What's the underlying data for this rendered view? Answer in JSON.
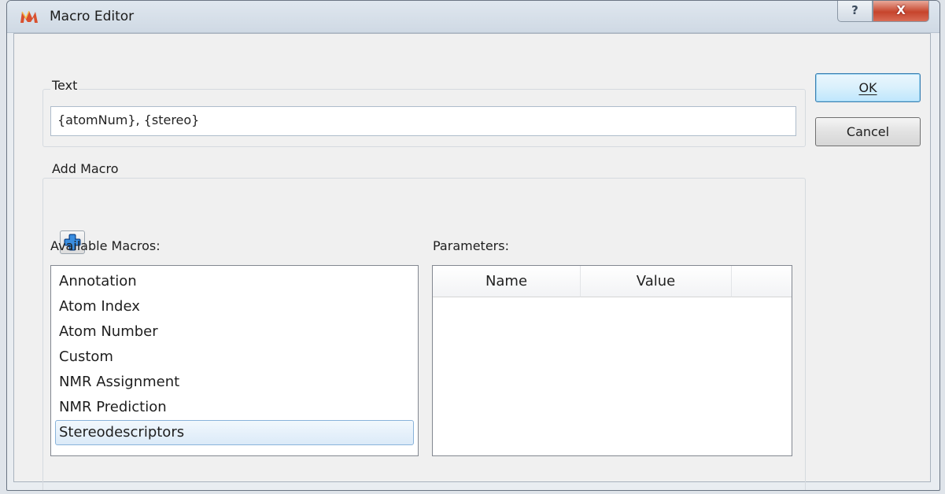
{
  "window": {
    "title": "Macro Editor",
    "help_glyph": "?",
    "close_glyph": "X"
  },
  "text_group": {
    "label": "Text",
    "value": "{atomNum}, {stereo}"
  },
  "add_macro_group": {
    "label": "Add Macro",
    "add_icon": "plus-icon"
  },
  "available_macros": {
    "label": "Available Macros:",
    "items": [
      "Annotation",
      "Atom Index",
      "Atom Number",
      "Custom",
      "NMR Assignment",
      "NMR Prediction",
      "Stereodescriptors"
    ],
    "selected": "Stereodescriptors"
  },
  "parameters": {
    "label": "Parameters:",
    "columns": [
      "Name",
      "Value"
    ]
  },
  "buttons": {
    "ok": "OK",
    "cancel": "Cancel"
  },
  "colors": {
    "plus_icon": "#1f6fc8",
    "selection": "#dbeaf8",
    "close_button": "#c6442c"
  }
}
